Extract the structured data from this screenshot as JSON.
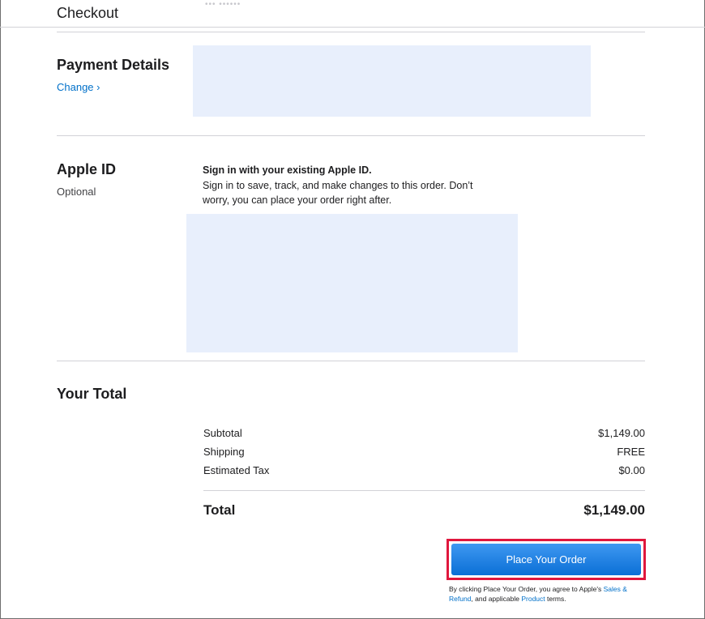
{
  "header": {
    "title": "Checkout",
    "faded_text": "••• ••••••"
  },
  "payment": {
    "title": "Payment Details",
    "change_link": "Change ›"
  },
  "apple_id": {
    "title": "Apple ID",
    "subtitle": "Optional",
    "signin_heading": "Sign in with your existing Apple ID.",
    "signin_body": "Sign in to save, track, and make changes to this order. Don’t worry, you can place your order right after."
  },
  "total": {
    "title": "Your Total",
    "lines": [
      {
        "label": "Subtotal",
        "value": "$1,149.00"
      },
      {
        "label": "Shipping",
        "value": "FREE"
      },
      {
        "label": "Estimated Tax",
        "value": "$0.00"
      }
    ],
    "total_label": "Total",
    "total_value": "$1,149.00"
  },
  "actions": {
    "place_order_label": "Place Your Order"
  },
  "terms": {
    "prefix": "By clicking Place Your Order, you agree to Apple's ",
    "sales_link": "Sales & Refund",
    "middle": ", and applicable ",
    "product_link": "Product",
    "suffix": " terms."
  },
  "colors": {
    "link": "#0070c9",
    "button": "#0a6fd6",
    "highlight": "#e0173d",
    "redacted_block": "#e8effc"
  }
}
